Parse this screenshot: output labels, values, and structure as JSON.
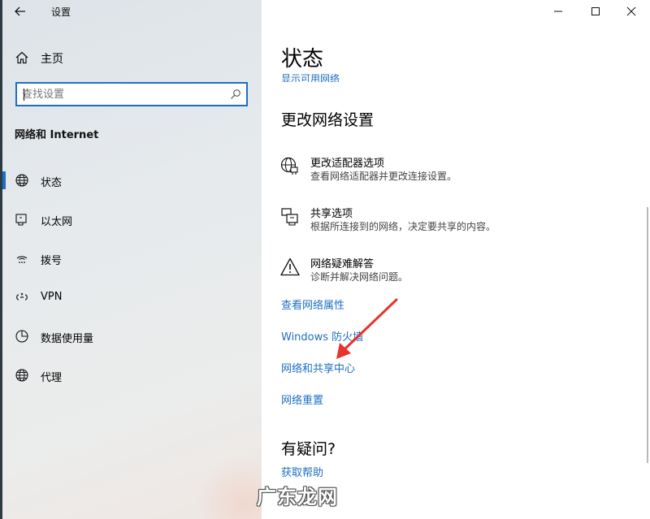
{
  "window": {
    "title": "设置",
    "controls": [
      "minimize-icon",
      "maximize-icon",
      "close-icon"
    ]
  },
  "sidebar": {
    "home_label": "主页",
    "search": {
      "value": "",
      "placeholder": "查找设置"
    },
    "section_title": "网络和 Internet",
    "items": [
      {
        "label": "状态",
        "icon": "globe-icon",
        "active": true
      },
      {
        "label": "以太网",
        "icon": "ethernet-icon",
        "active": false
      },
      {
        "label": "拨号",
        "icon": "dialup-icon",
        "active": false
      },
      {
        "label": "VPN",
        "icon": "vpn-icon",
        "active": false
      },
      {
        "label": "数据使用量",
        "icon": "data-usage-icon",
        "active": false
      },
      {
        "label": "代理",
        "icon": "globe-icon",
        "active": false
      }
    ]
  },
  "main": {
    "title": "状态",
    "cut_link": "显示可用网络",
    "change_settings": {
      "heading": "更改网络设置",
      "options": [
        {
          "title": "更改适配器选项",
          "desc": "查看网络适配器并更改连接设置。",
          "icon": "adapter-icon"
        },
        {
          "title": "共享选项",
          "desc": "根据所连接到的网络，决定要共享的内容。",
          "icon": "sharing-icon"
        },
        {
          "title": "网络疑难解答",
          "desc": "诊断并解决网络问题。",
          "icon": "warning-icon"
        }
      ]
    },
    "links": [
      "查看网络属性",
      "Windows 防火墙",
      "网络和共享中心",
      "网络重置"
    ],
    "help": {
      "heading": "有疑问?",
      "link": "获取帮助"
    }
  },
  "annotation": {
    "color": "#e8322b"
  },
  "watermark": "广东龙网",
  "colors": {
    "accent": "#1d6fc4"
  }
}
